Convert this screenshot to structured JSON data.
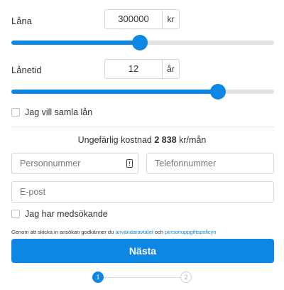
{
  "loan": {
    "label": "Låna",
    "amount": "300000",
    "unit": "kr",
    "slider_fraction": 0.49
  },
  "term": {
    "label": "Lånetid",
    "years": "12",
    "unit": "år",
    "slider_fraction": 0.786
  },
  "consolidate": {
    "label": "Jag vill samla lån",
    "checked": false
  },
  "cost": {
    "prefix": "Ungefärlig kostnad",
    "amount": "2 838",
    "suffix": "kr/mån"
  },
  "fields": {
    "personal_number_placeholder": "Personnummer",
    "phone_placeholder": "Telefonnummer",
    "email_placeholder": "E-post"
  },
  "co_applicant": {
    "label": "Jag har medsökande",
    "checked": false
  },
  "terms": {
    "text": "Genom att skicka in ansökan godkänner du",
    "link_user_agreement": "användaravtalet",
    "and": "och",
    "link_privacy": "personuppgiftspolicyn"
  },
  "next_button": "Nästa",
  "stepper": {
    "step1": "1",
    "step2": "2"
  },
  "colors": {
    "accent": "#0e86e4",
    "track": "#e2e2e2"
  }
}
